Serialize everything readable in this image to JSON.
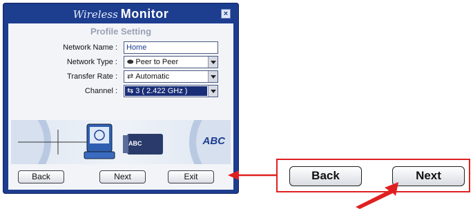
{
  "window": {
    "title_script": "Wireless",
    "title_bold": "Monitor",
    "close_glyph": "×",
    "subtitle": "Profile Setting"
  },
  "form": {
    "network_name": {
      "label": "Network Name :",
      "value": "Home"
    },
    "network_type": {
      "label": "Network Type :",
      "value": "Peer to Peer",
      "icon": "peer-icon"
    },
    "transfer_rate": {
      "label": "Transfer Rate :",
      "value": "Automatic",
      "icon": "arrows-icon"
    },
    "channel": {
      "label": "Channel :",
      "value": "3 ( 2.422 GHz )",
      "icon": "channel-icon"
    }
  },
  "illustration": {
    "screen_text": "ABC",
    "big_text": "ABC"
  },
  "buttons": {
    "back": "Back",
    "next": "Next",
    "exit": "Exit"
  },
  "callout": {
    "back": "Back",
    "next": "Next"
  },
  "colors": {
    "window_blue": "#1d3d8f",
    "highlight": "#1a2d77",
    "callout_red": "#e02020"
  }
}
